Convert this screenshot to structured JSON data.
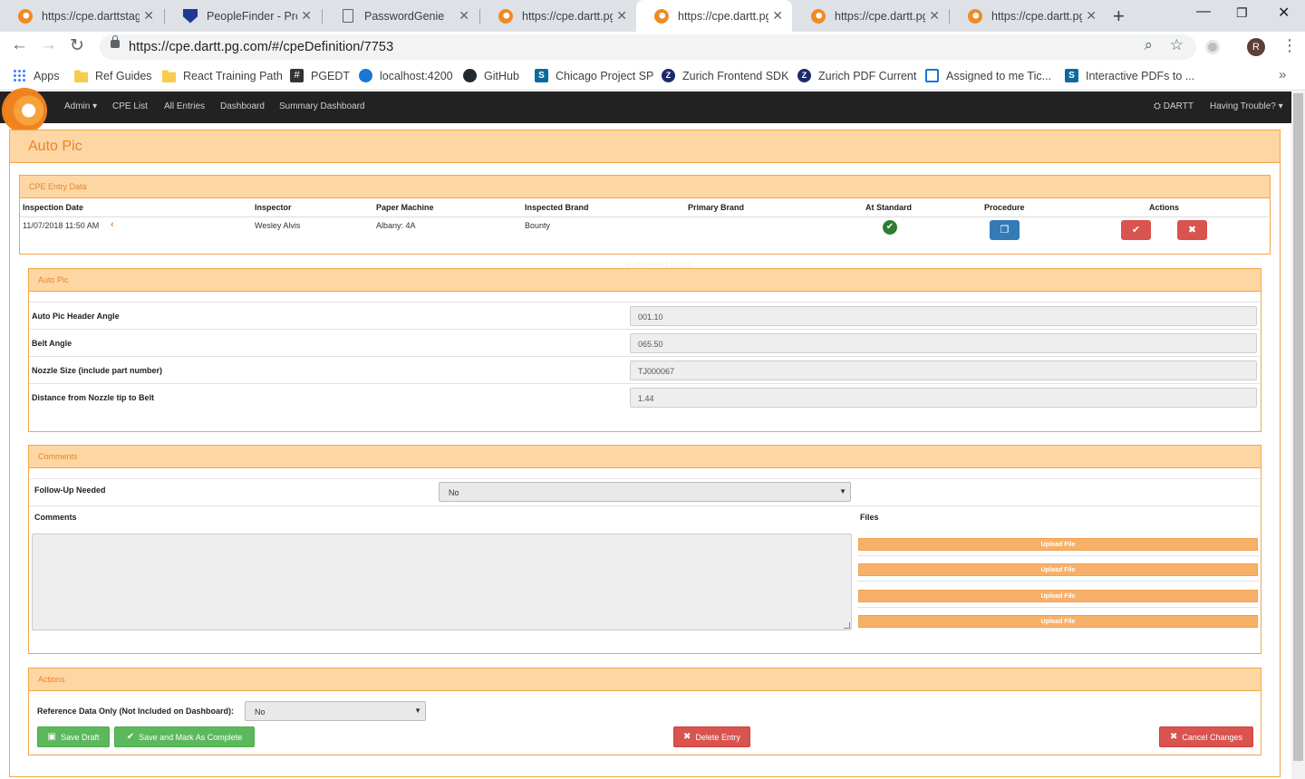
{
  "browser": {
    "tabs": [
      {
        "title": "https://cpe.darttstag",
        "icon": "dartt-favicon"
      },
      {
        "title": "PeopleFinder - Profil",
        "icon": "shield-favicon"
      },
      {
        "title": "PasswordGenie",
        "icon": "doc-favicon"
      },
      {
        "title": "https://cpe.dartt.pg.c",
        "icon": "dartt-favicon"
      },
      {
        "title": "https://cpe.dartt.pg.c",
        "icon": "dartt-favicon",
        "active": true
      },
      {
        "title": "https://cpe.dartt.pg.c",
        "icon": "dartt-favicon"
      },
      {
        "title": "https://cpe.dartt.pg.c",
        "icon": "dartt-favicon"
      }
    ],
    "url": "https://cpe.dartt.pg.com/#/cpeDefinition/7753",
    "profile_initial": "R",
    "bookmarks": [
      {
        "label": "Apps"
      },
      {
        "label": "Ref Guides"
      },
      {
        "label": "React Training Path"
      },
      {
        "label": "PGEDT"
      },
      {
        "label": "localhost:4200"
      },
      {
        "label": "GitHub"
      },
      {
        "label": "Chicago Project SP"
      },
      {
        "label": "Zurich Frontend SDK"
      },
      {
        "label": "Zurich PDF Current"
      },
      {
        "label": "Assigned to me Tic..."
      },
      {
        "label": "Interactive PDFs to ..."
      }
    ]
  },
  "navbar": {
    "items": [
      "Admin",
      "CPE List",
      "All Entries",
      "Dashboard",
      "Summary Dashboard"
    ],
    "right_brand": "DARTT",
    "right_help": "Having Trouble?"
  },
  "page": {
    "title": "Auto Pic"
  },
  "cpe_entry": {
    "panel_title": "CPE Entry Data",
    "headers": [
      "Inspection Date",
      "Inspector",
      "Paper Machine",
      "Inspected Brand",
      "Primary Brand",
      "At Standard",
      "Procedure",
      "Actions"
    ],
    "row": {
      "inspection_date": "11/07/2018 11:50 AM",
      "inspector": "Wesley Alvis",
      "paper_machine": "Albany: 4A",
      "inspected_brand": "Bounty",
      "primary_brand": ""
    }
  },
  "auto_pic": {
    "panel_title": "Auto Pic",
    "faint_text": "Retrieved Data",
    "fields": [
      {
        "label": "Auto Pic Header Angle",
        "value": "001.10"
      },
      {
        "label": "Belt Angle",
        "value": "065.50"
      },
      {
        "label": "Nozzle Size (include part number)",
        "value": "TJ000067"
      },
      {
        "label": "Distance from Nozzle tip to Belt",
        "value": "1.44"
      }
    ]
  },
  "comments": {
    "panel_title": "Comments",
    "follow_up_label": "Follow-Up Needed",
    "follow_up_value": "No",
    "comments_label": "Comments",
    "comments_value": "",
    "files_label": "Files",
    "upload_label": "Upload File"
  },
  "actions": {
    "panel_title": "Actions",
    "reference_label": "Reference Data Only (Not Included on Dashboard):",
    "reference_value": "No",
    "save_draft": "Save Draft",
    "save_complete": "Save and Mark As Complete",
    "delete_entry": "Delete Entry",
    "cancel_changes": "Cancel Changes"
  },
  "colors": {
    "accent_orange": "#e8852a",
    "panel_header_bg": "#fdd6a4",
    "panel_border": "#f2a649",
    "success_green": "#5cb85c",
    "danger_red": "#d9534f",
    "primary_blue": "#337ab7"
  }
}
